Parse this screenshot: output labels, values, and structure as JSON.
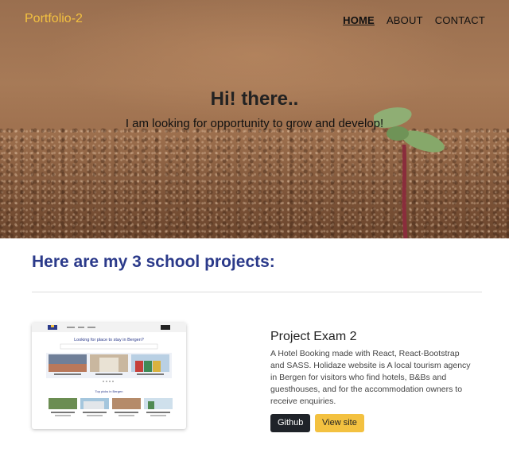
{
  "header": {
    "brand": "Portfolio-2",
    "nav": [
      {
        "label": "HOME",
        "active": true
      },
      {
        "label": "ABOUT",
        "active": false
      },
      {
        "label": "CONTACT",
        "active": false
      }
    ]
  },
  "hero": {
    "title": "Hi! there..",
    "subtitle": "I am looking for opportunity to grow and develop!"
  },
  "projects": {
    "heading": "Here are my 3 school projects:",
    "items": [
      {
        "title": "Project Exam 2",
        "description": "A Hotel Booking made with React, React-Bootstrap and SASS. Holidaze website is A local tourism agency in Bergen for visitors who find hotels, B&Bs and guesthouses, and for the accommodation owners to receive enquiries.",
        "buttons": {
          "github": "Github",
          "view": "View site"
        },
        "thumbnail": {
          "headline": "Looking for place to stay in Bergen?",
          "section": "Top picks in Bergen"
        }
      }
    ]
  },
  "colors": {
    "brand": "#f3c140",
    "heading": "#2b3a8a",
    "github_button": "#1f2329",
    "view_button": "#f3c140"
  }
}
